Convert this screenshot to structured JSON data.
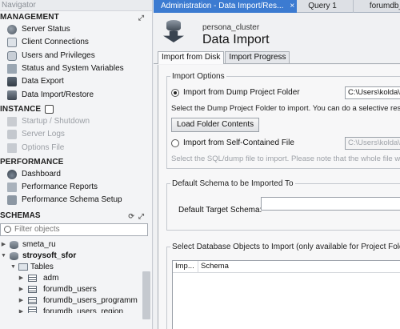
{
  "navigator": {
    "header": "Navigator",
    "management": {
      "title": "MANAGEMENT",
      "items": [
        {
          "label": "Server Status",
          "icon": "server-status-icon"
        },
        {
          "label": "Client Connections",
          "icon": "client-connections-icon"
        },
        {
          "label": "Users and Privileges",
          "icon": "users-icon"
        },
        {
          "label": "Status and System Variables",
          "icon": "variables-icon"
        },
        {
          "label": "Data Export",
          "icon": "data-export-icon"
        },
        {
          "label": "Data Import/Restore",
          "icon": "data-import-icon"
        }
      ]
    },
    "instance": {
      "title": "INSTANCE",
      "items": [
        {
          "label": "Startup / Shutdown",
          "icon": "startup-icon"
        },
        {
          "label": "Server Logs",
          "icon": "server-logs-icon"
        },
        {
          "label": "Options File",
          "icon": "options-file-icon"
        }
      ]
    },
    "performance": {
      "title": "PERFORMANCE",
      "items": [
        {
          "label": "Dashboard",
          "icon": "dashboard-icon"
        },
        {
          "label": "Performance Reports",
          "icon": "performance-reports-icon"
        },
        {
          "label": "Performance Schema Setup",
          "icon": "schema-setup-icon"
        }
      ]
    },
    "schemas": {
      "title": "SCHEMAS",
      "filter_placeholder": "Filter objects",
      "tree": [
        {
          "label": "smeta_ru"
        },
        {
          "label": "stroysoft_sfor"
        },
        {
          "label": "Tables"
        },
        {
          "label": "adm"
        },
        {
          "label": "forumdb_users"
        },
        {
          "label": "forumdb_users_programm"
        },
        {
          "label": "forumdb_users_region"
        }
      ]
    }
  },
  "tabs": [
    {
      "label": "Administration - Data Import/Res...",
      "close": "×"
    },
    {
      "label": "Query 1"
    },
    {
      "label": "forumdb_users"
    }
  ],
  "header": {
    "connection": "persona_cluster",
    "title": "Data Import"
  },
  "subtabs": [
    "Import from Disk",
    "Import Progress"
  ],
  "import_options": {
    "title": "Import Options",
    "option1": "Import from Dump Project Folder",
    "option1_path": "C:\\Users\\kolda\\D",
    "option1_desc": "Select the Dump Project Folder to import. You can do a selective restore.",
    "load_button": "Load Folder Contents",
    "option2": "Import from Self-Contained File",
    "option2_path": "C:\\Users\\kolda\\D",
    "option2_desc": "Select the SQL/dump file to import. Please note that the whole file will be"
  },
  "default_schema": {
    "title": "Default Schema to be Imported To",
    "label": "Default Target Schema:"
  },
  "objects": {
    "title": "Select Database Objects to Import (only available for Project Folders)",
    "columns": [
      "Imp...",
      "Schema"
    ]
  }
}
